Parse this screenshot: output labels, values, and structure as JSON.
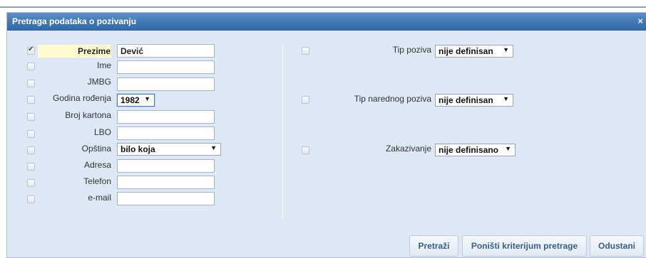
{
  "dialog": {
    "title": "Pretraga podataka o pozivanju",
    "close_icon": "×"
  },
  "left": {
    "prezime": {
      "label": "Prezime",
      "value": "Dević",
      "checked": true
    },
    "ime": {
      "label": "Ime",
      "value": ""
    },
    "jmbg": {
      "label": "JMBG",
      "value": ""
    },
    "godina": {
      "label": "Godina rođenja",
      "value": "1982"
    },
    "broj_kartona": {
      "label": "Broj kartona",
      "value": ""
    },
    "lbo": {
      "label": "LBO",
      "value": ""
    },
    "opstina": {
      "label": "Opština",
      "value": "bilo koja"
    },
    "adresa": {
      "label": "Adresa",
      "value": ""
    },
    "telefon": {
      "label": "Telefon",
      "value": ""
    },
    "email": {
      "label": "e-mail",
      "value": ""
    }
  },
  "right": {
    "tip_poziva": {
      "label": "Tip poziva",
      "value": "nije definisan"
    },
    "tip_narednog": {
      "label": "Tip narednog poziva",
      "value": "nije definisan"
    },
    "zakazivanje": {
      "label": "Zakazivanje",
      "value": "nije definisano"
    }
  },
  "buttons": {
    "search": "Pretraži",
    "reset": "Poništi kriterijum pretrage",
    "cancel": "Odustani"
  },
  "icons": {
    "dropdown_arrow": "▼"
  }
}
